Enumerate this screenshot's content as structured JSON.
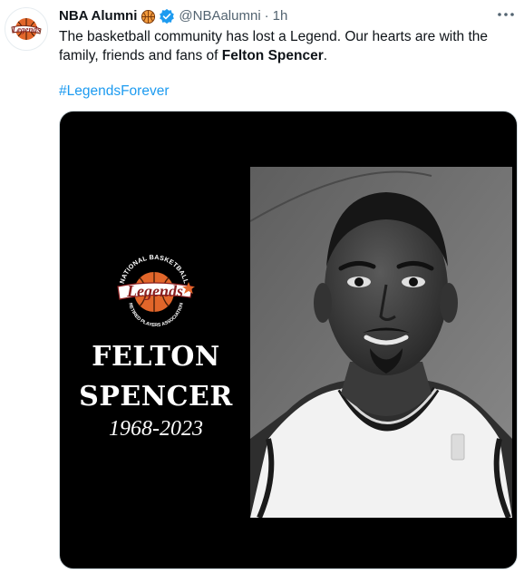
{
  "author": {
    "display_name": "NBA Alumni",
    "handle": "@NBAalumni",
    "separator": "·",
    "time": "1h",
    "avatar_icon": "legends-logo-icon",
    "verified_icon": "verified-badge-icon",
    "emoji_icon": "basketball-icon"
  },
  "tweet": {
    "text_part1": "The basketball community has lost a Legend. Our hearts are with the family, friends and fans of ",
    "text_bold": "Felton Spencer",
    "text_end": ".",
    "hashtag": "#LegendsForever"
  },
  "media": {
    "logo_top_text": "NATIONAL BASKETBALL",
    "logo_script_text": "Legends",
    "logo_bottom_text": "RETIRED PLAYERS ASSOCIATION",
    "name_line1": "FELTON",
    "name_line2": "SPENCER",
    "years": "1968-2023"
  },
  "colors": {
    "accent": "#1d9bf0",
    "text": "#0f1419",
    "muted": "#536471",
    "media_bg": "#000000",
    "logo_orange": "#e2662a"
  }
}
